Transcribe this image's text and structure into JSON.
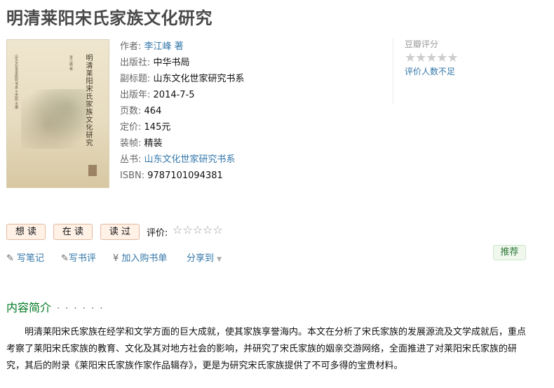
{
  "book": {
    "title": "明清莱阳宋氏家族文化研究",
    "cover": {
      "vertical_title": "明清莱阳宋氏家族文化研究",
      "author_line": "李江峰 著",
      "series_line": "山东文化世家研究书系 王志民 主编"
    },
    "info": [
      {
        "label": "作者:",
        "value": "李江峰 著",
        "link": true
      },
      {
        "label": "出版社:",
        "value": "中华书局",
        "link": false
      },
      {
        "label": "副标题:",
        "value": "山东文化世家研究书系",
        "link": false
      },
      {
        "label": "出版年:",
        "value": "2014-7-5",
        "link": false
      },
      {
        "label": "页数:",
        "value": "464",
        "link": false
      },
      {
        "label": "定价:",
        "value": "145元",
        "link": false
      },
      {
        "label": "装帧:",
        "value": "精装",
        "link": false
      },
      {
        "label": "丛书:",
        "value": "山东文化世家研究书系",
        "link": true
      },
      {
        "label": "ISBN:",
        "value": "9787101094381",
        "link": false
      }
    ]
  },
  "rating": {
    "label": "豆瓣评分",
    "stars": "★★★★★",
    "note": "评价人数不足"
  },
  "buttons": {
    "want": "想 读",
    "reading": "在 读",
    "read": "读 过"
  },
  "user_rating": {
    "label": "评价:",
    "stars": "☆☆☆☆☆"
  },
  "actions": {
    "write_note": "写笔记",
    "write_review": "写书评",
    "add_cart": "加入购书单",
    "share": "分享到",
    "currency_symbol": "¥"
  },
  "recommend": "推荐",
  "intro": {
    "heading": "内容简介",
    "dots": "· · · · · ·",
    "text": "明清莱阳宋氏家族在经学和文学方面的巨大成就，使其家族享誉海内。本文在分析了宋氏家族的发展源流及文学成就后，重点考察了莱阳宋氏家族的教育、文化及其对地方社会的影响，并研究了宋氏家族的姻亲交游网络，全面推进了对莱阳宋氏家族的研究，其后的附录《莱阳宋氏家族作家作品辑存》，更是为研究宋氏家族提供了不可多得的宝贵材料。"
  },
  "colors": {
    "link": "#3377aa",
    "green": "#007722",
    "button_bg": "#fff1e6"
  }
}
